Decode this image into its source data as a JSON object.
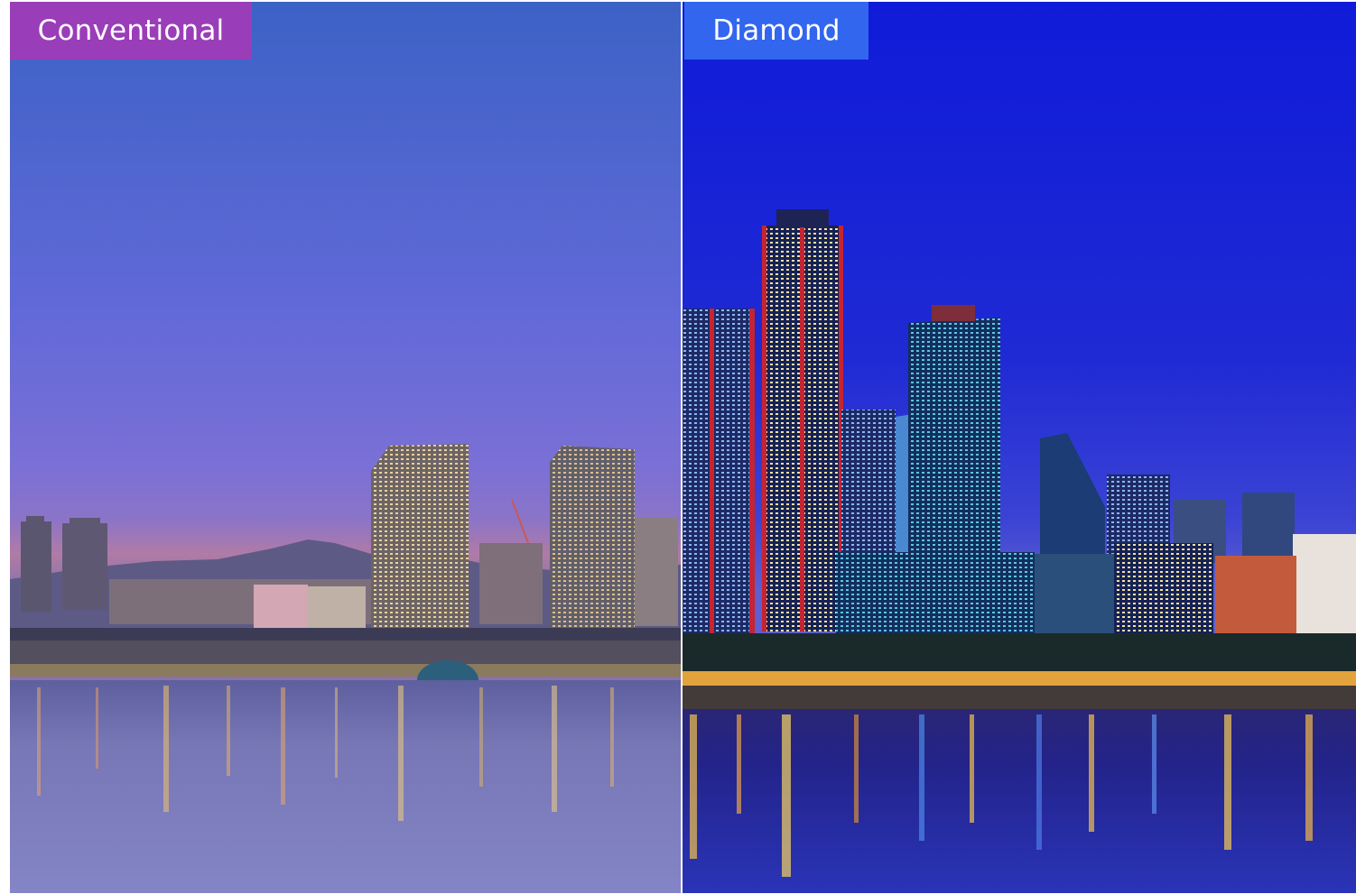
{
  "comparison": {
    "left": {
      "label": "Conventional",
      "label_bg": "#9a3db8",
      "sky_top": "#3d63c6",
      "sky_mid": "#6d6fd8",
      "sky_horizon": "#8a74cc",
      "water": "#7a79bd"
    },
    "right": {
      "label": "Diamond",
      "label_bg": "#3366ee",
      "sky_top": "#1222d8",
      "sky_mid": "#2a34d6",
      "sky_horizon": "#4b58cf",
      "water": "#1c1b78"
    }
  }
}
